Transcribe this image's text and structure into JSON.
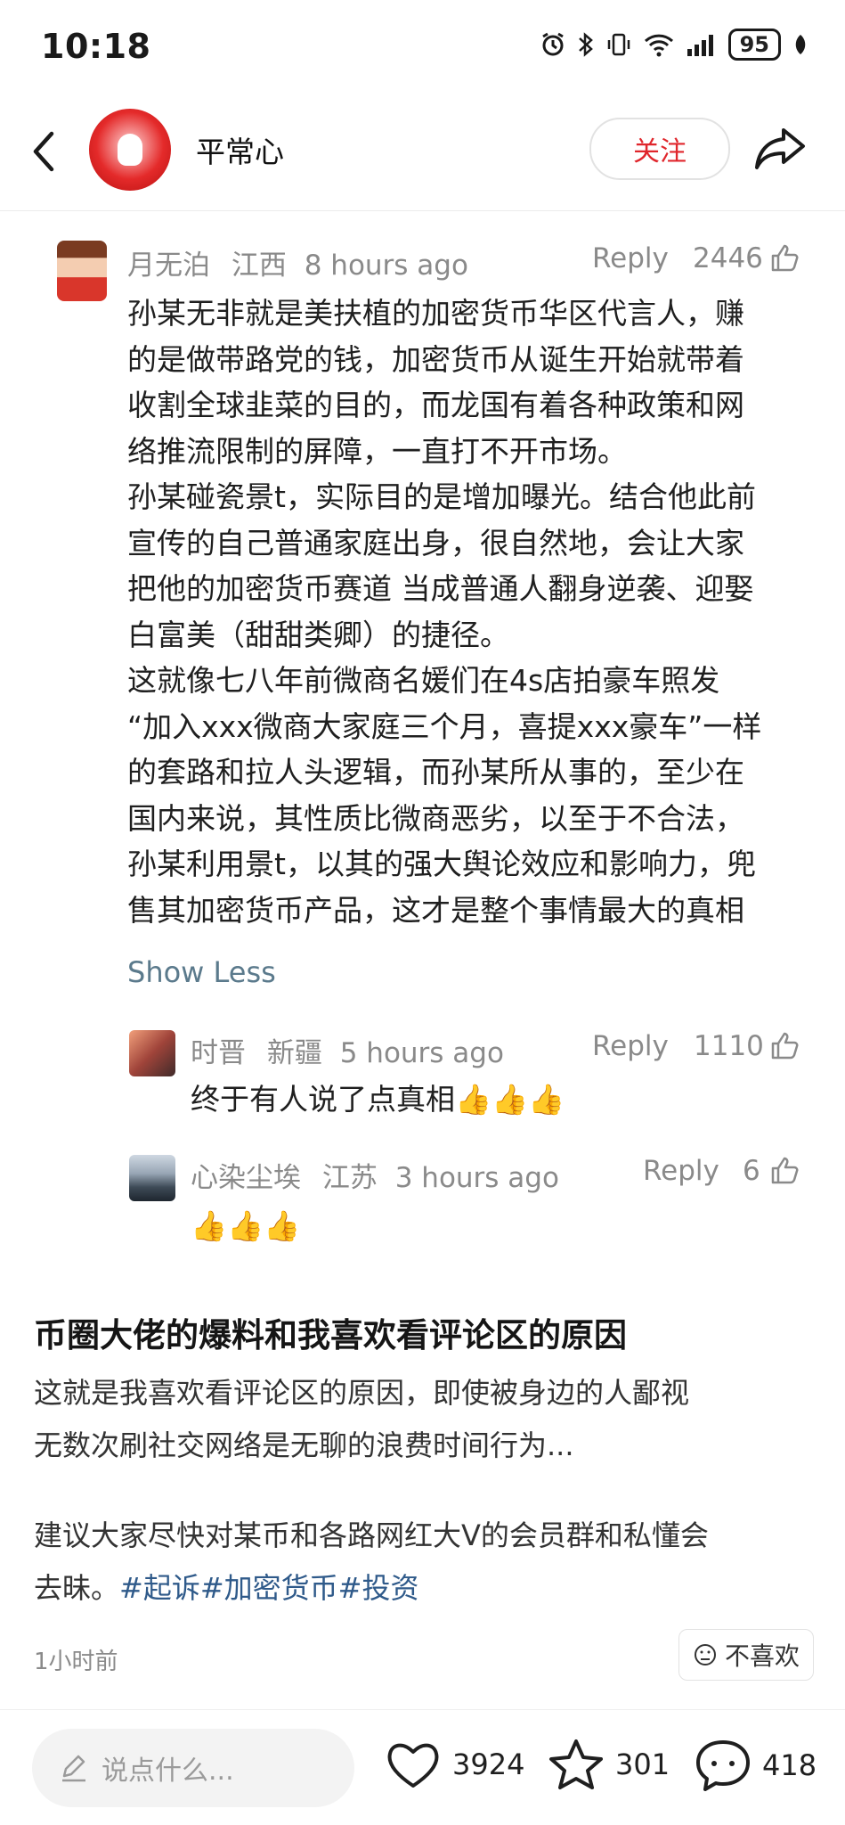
{
  "status_bar": {
    "time": "10:18",
    "battery": "95"
  },
  "header": {
    "user_name": "平常心",
    "follow_label": "关注"
  },
  "comments": [
    {
      "user": "月无泊",
      "region": "江西",
      "time": "8 hours ago",
      "reply_label": "Reply",
      "likes": "2446",
      "lines": [
        "孙某无非就是美扶植的加密货币华区代言人，赚",
        "的是做带路党的钱，加密货币从诞生开始就带着",
        "收割全球韭菜的目的，而龙国有着各种政策和网",
        "络推流限制的屏障，一直打不开市场。",
        "孙某碰瓷景t，实际目的是增加曝光。结合他此前",
        "宣传的自己普通家庭出身，很自然地，会让大家",
        "把他的加密货币赛道 当成普通人翻身逆袭、迎娶",
        "白富美（甜甜类卿）的捷径。",
        "这就像七八年前微商名媛们在4s店拍豪车照发",
        "“加入xxx微商大家庭三个月，喜提xxx豪车”一样",
        "的套路和拉人头逻辑，而孙某所从事的，至少在",
        "国内来说，其性质比微商恶劣，以至于不合法，",
        "孙某利用景t，以其的强大舆论效应和影响力，兜",
        "售其加密货币产品，这才是整个事情最大的真相"
      ],
      "show_less": "Show Less"
    },
    {
      "user": "时晋",
      "region": "新疆",
      "time": "5 hours ago",
      "reply_label": "Reply",
      "likes": "1110",
      "text": "终于有人说了点真相👍👍👍"
    },
    {
      "user": "心染尘埃",
      "region": "江苏",
      "time": "3 hours ago",
      "reply_label": "Reply",
      "likes": "6",
      "text": "👍👍👍"
    }
  ],
  "article": {
    "title": "币圈大佬的爆料和我喜欢看评论区的原因",
    "para1_line1": "这就是我喜欢看评论区的原因，即使被身边的人鄙视",
    "para1_line2": "无数次刷社交网络是无聊的浪费时间行为...",
    "para2_line1": "建议大家尽快对某币和各路网红大V的会员群和私懂会",
    "para2_prefix": "去昧。",
    "hashtags": [
      "#起诉",
      "#加密货币",
      "#投资"
    ],
    "time_ago": "1小时前",
    "dislike_label": "不喜欢"
  },
  "bottom_bar": {
    "input_placeholder": "说点什么...",
    "likes": "3924",
    "favorites": "301",
    "comments": "418"
  },
  "colors": {
    "accent_red": "#e0262c",
    "link_blue": "#2f5a8a",
    "meta_gray": "#8a8a8a"
  }
}
